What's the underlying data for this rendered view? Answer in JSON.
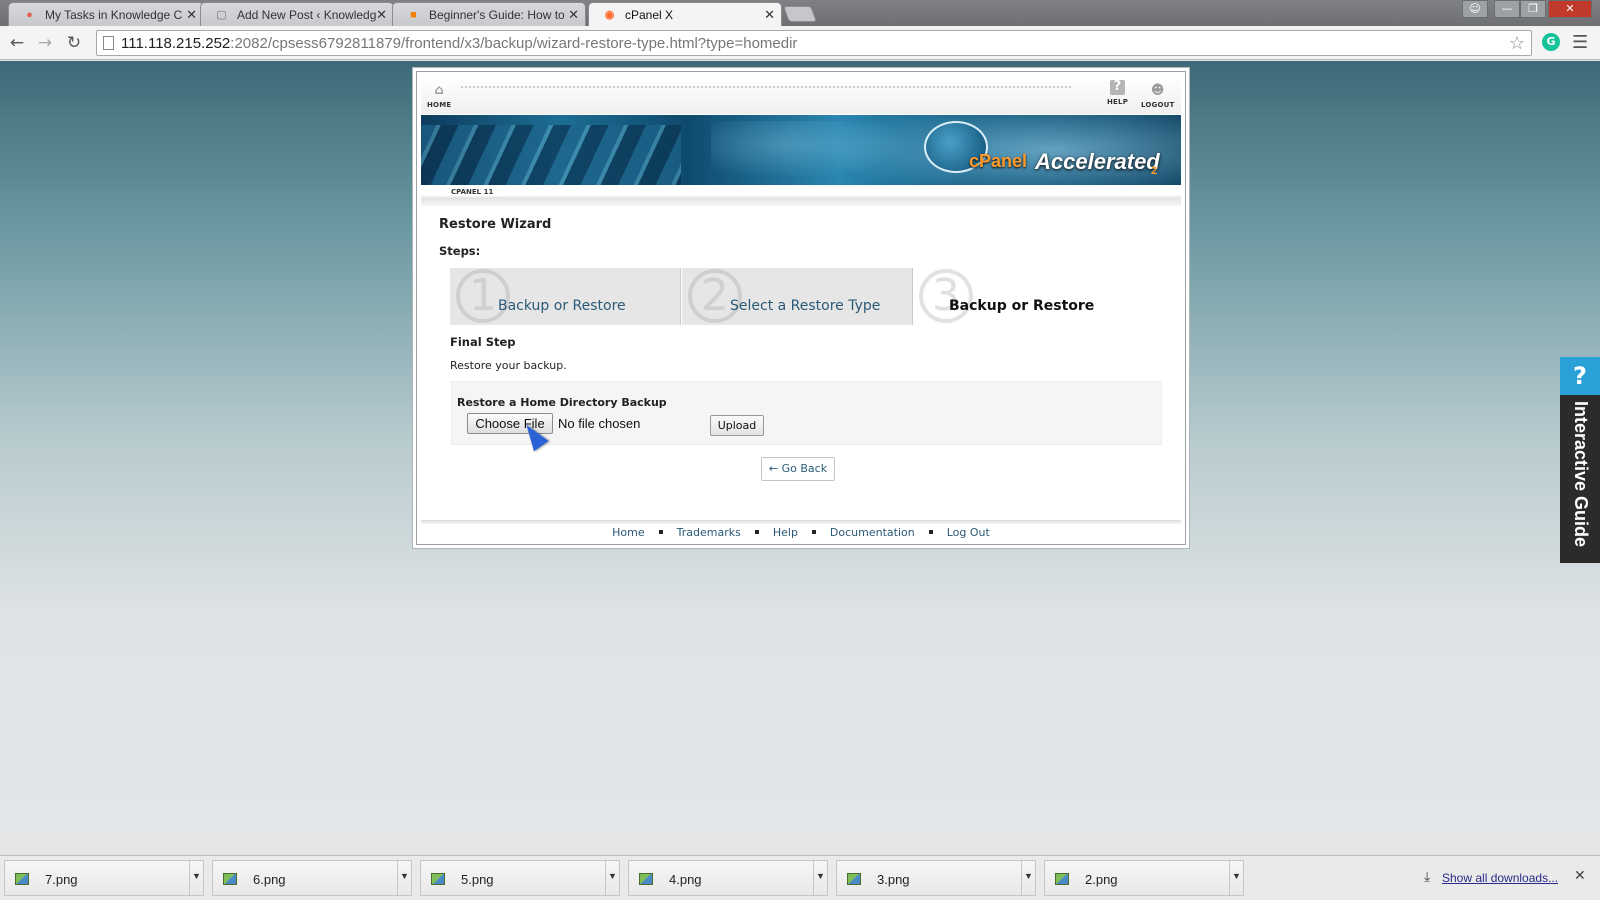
{
  "browser": {
    "tabs": [
      {
        "title": "My Tasks in Knowledge C",
        "icon": "asana-icon",
        "active": false
      },
      {
        "title": "Add New Post ‹ Knowledg",
        "icon": "page-icon",
        "active": false
      },
      {
        "title": "Beginner's Guide: How to",
        "icon": "blogger-icon",
        "active": false
      },
      {
        "title": "cPanel X",
        "icon": "cpanel-icon",
        "active": true
      }
    ],
    "url_host": "111.118.215.252",
    "url_rest": ":2082/cpsess6792811879/frontend/x3/backup/wizard-restore-type.html?type=homedir"
  },
  "cpanel": {
    "nav": {
      "home": "HOME",
      "help": "HELP",
      "logout": "LOGOUT"
    },
    "logo_main": "cPanel",
    "logo_accel": "Accelerated",
    "logo_sub": "2",
    "version": "CPANEL 11",
    "title": "Restore Wizard",
    "steps_label": "Steps:",
    "steps": [
      {
        "num": "1",
        "label": "Backup or Restore"
      },
      {
        "num": "2",
        "label": "Select a Restore Type"
      },
      {
        "num": "3",
        "label": "Backup or Restore"
      }
    ],
    "final_step": "Final Step",
    "description": "Restore your backup.",
    "restore_title": "Restore a Home Directory Backup",
    "choose_file": "Choose File",
    "no_file": "No file chosen",
    "upload": "Upload",
    "go_back": "← Go Back",
    "footer": [
      "Home",
      "Trademarks",
      "Help",
      "Documentation",
      "Log Out"
    ]
  },
  "guide": {
    "q": "?",
    "label": "Interactive Guide"
  },
  "downloads": {
    "files": [
      "7.png",
      "6.png",
      "5.png",
      "4.png",
      "3.png",
      "2.png"
    ],
    "show_all": "Show all downloads..."
  }
}
